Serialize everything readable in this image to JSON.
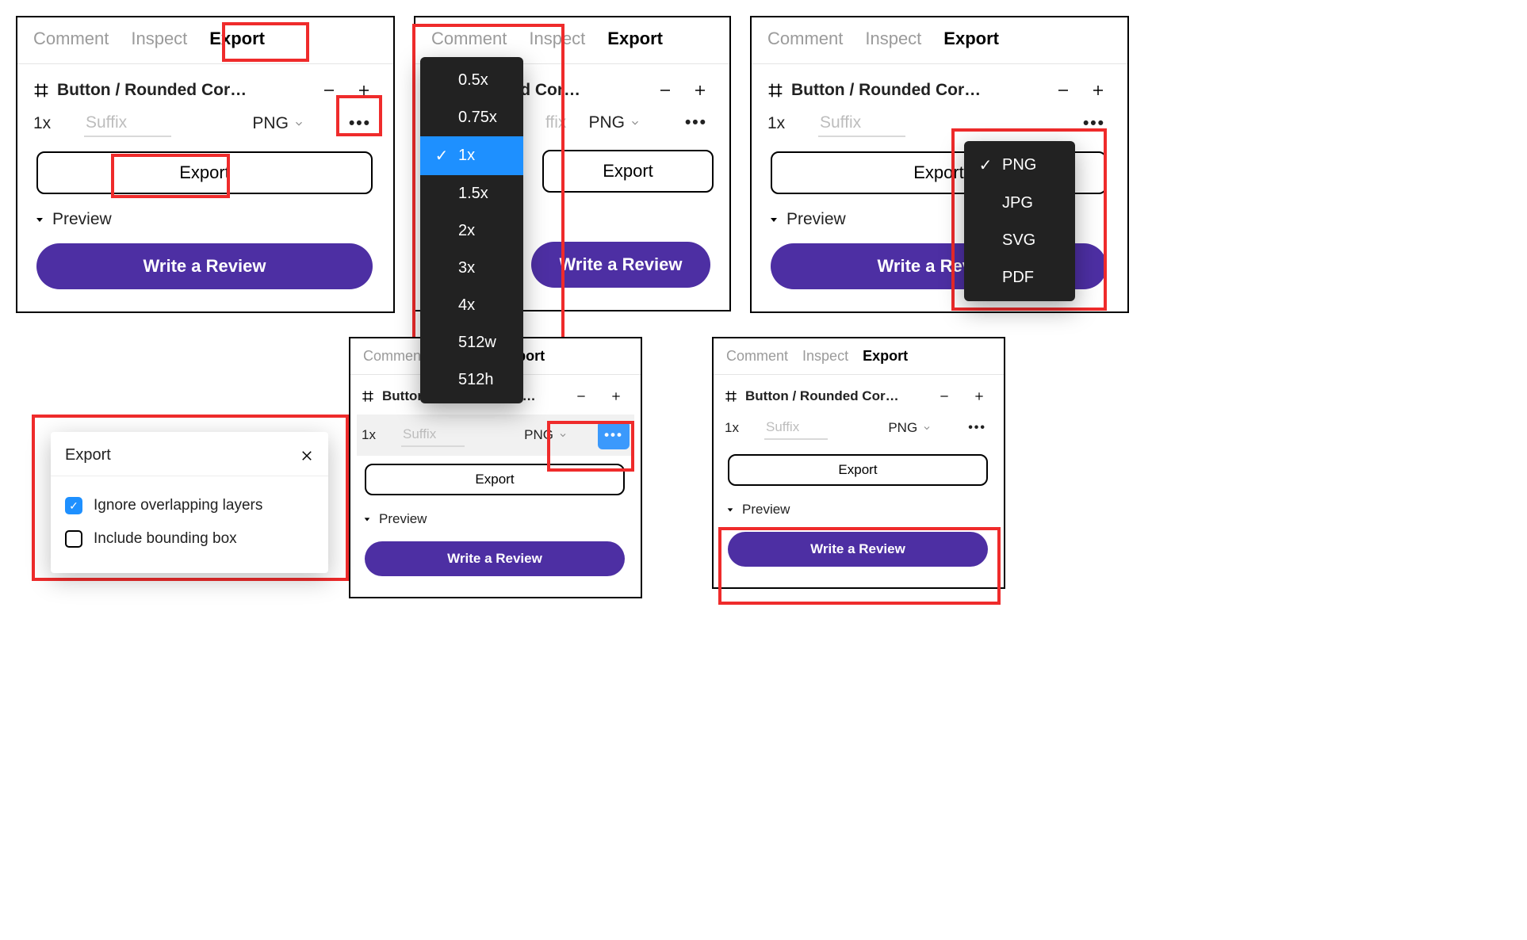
{
  "tabs": {
    "comment": "Comment",
    "inspect": "Inspect",
    "export": "Export"
  },
  "layer_name": "Button / Rounded Cor…",
  "export_row": {
    "scale": "1x",
    "suffix_placeholder": "Suffix",
    "format": "PNG"
  },
  "export_button": "Export",
  "preview_label": "Preview",
  "review_button": "Write a Review",
  "scale_menu": {
    "items": [
      "0.5x",
      "0.75x",
      "1x",
      "1.5x",
      "2x",
      "3x",
      "4x",
      "512w",
      "512h"
    ],
    "selected": "1x"
  },
  "format_menu": {
    "items": [
      "PNG",
      "JPG",
      "SVG",
      "PDF"
    ],
    "selected": "PNG"
  },
  "options_popover": {
    "title": "Export",
    "opt1": "Ignore overlapping layers",
    "opt2": "Include bounding box",
    "opt1_checked": true,
    "opt2_checked": false
  }
}
